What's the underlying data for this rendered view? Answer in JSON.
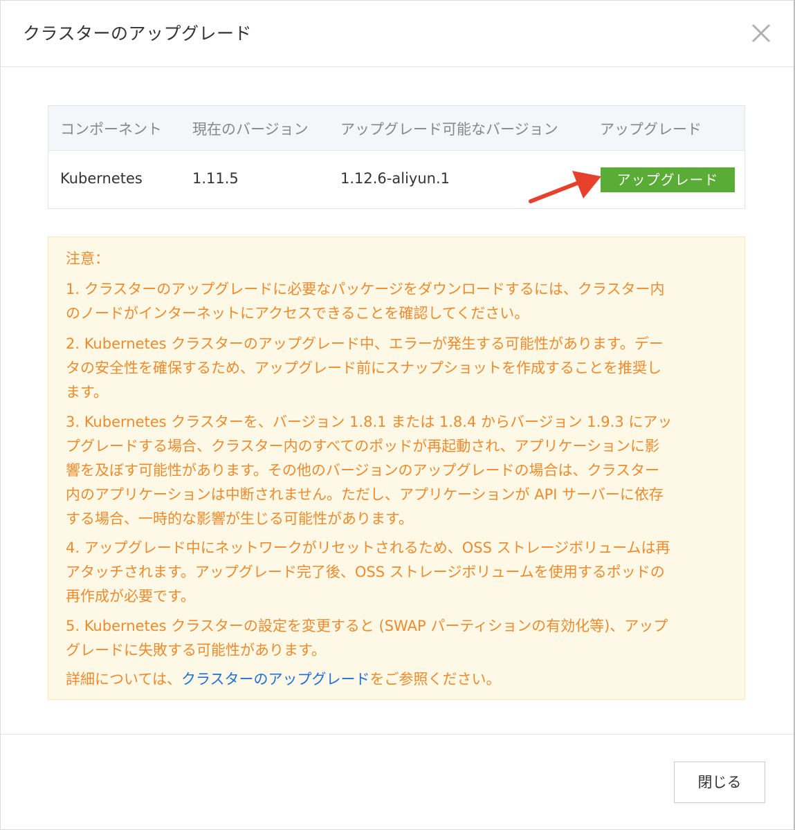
{
  "dialog": {
    "title": "クラスターのアップグレード"
  },
  "table": {
    "headers": [
      "コンポーネント",
      "現在のバージョン",
      "アップグレード可能なバージョン",
      "アップグレード"
    ],
    "rows": [
      {
        "component": "Kubernetes",
        "current": "1.11.5",
        "available": "1.12.6-aliyun.1",
        "action": "アップグレード"
      }
    ]
  },
  "notice": {
    "lines": [
      "注意：",
      "1. クラスターのアップグレードに必要なパッケージをダウンロードするには、クラスター内",
      "のノードがインターネットにアクセスできることを確認してください。",
      "2. Kubernetes クラスターのアップグレード中、エラーが発生する可能性があります。デー",
      "タの安全性を確保するため、アップグレード前にスナップショットを作成することを推奨し",
      "ます。",
      "3. Kubernetes クラスターを、バージョン 1.8.1 または 1.8.4 からバージョン 1.9.3 にアッ",
      "プグレードする場合、クラスター内のすべてのポッドが再起動され、アプリケーションに影",
      "響を及ぼす可能性があります。その他のバージョンのアップグレードの場合は、クラスター",
      "内のアプリケーションは中断されません。ただし、アプリケーションが API サーバーに依存",
      "する場合、一時的な影響が生じる可能性があります。",
      "4. アップグレード中にネットワークがリセットされるため、OSS ストレージボリュームは再",
      "アタッチされます。アップグレード完了後、OSS ストレージボリュームを使用するポッドの",
      "再作成が必要です。",
      "5. Kubernetes クラスターの設定を変更すると (SWAP パーティションの有効化等)、アップ",
      "グレードに失敗する可能性があります。"
    ],
    "details_prefix": "詳細については、",
    "details_link": "クラスターのアップグレード",
    "details_suffix": "をご参照ください。"
  },
  "footer": {
    "close_label": "閉じる"
  },
  "colors": {
    "upgrade_button": "#59ac35",
    "notice_text": "#f08a2a",
    "notice_bg": "#fef8e6",
    "link": "#1e6fd9",
    "arrow": "#e8412b"
  },
  "icons": {
    "close": "close-icon",
    "annotation": "red-arrow"
  }
}
